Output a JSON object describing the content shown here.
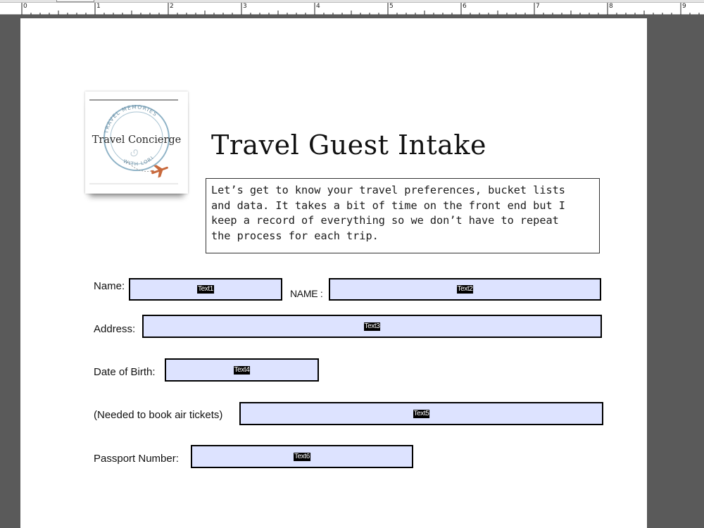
{
  "ruler": {
    "numbers": [
      "0",
      "1",
      "2",
      "3",
      "4",
      "5",
      "6",
      "7",
      "8",
      "9"
    ]
  },
  "logo": {
    "arc_top": "TRAVEL MEMORIES",
    "brand": "Travel Concierge",
    "arc_bottom": "WITH LORI",
    "accent": "#c8693c"
  },
  "title": "Travel Guest Intake",
  "intro_lines": [
    "Let’s get to know your travel preferences, bucket lists",
    "and data. It takes a bit of time on the front end but I",
    "keep a record of everything so we don’t have to repeat",
    "the process for each trip."
  ],
  "form": {
    "name_label": "Name:",
    "name_field": "Text1",
    "name2_label": "NAME :",
    "name2_field": "Text2",
    "address_label": "Address:",
    "address_field": "Text3",
    "dob_label": "Date of Birth:",
    "dob_field": "Text4",
    "air_label": "(Needed to book air tickets)",
    "air_field": "Text5",
    "passport_label": "Passport Number:",
    "passport_field": "Text6"
  },
  "colors": {
    "field_fill": "#dde3ff",
    "workspace": "#5a5a5a"
  }
}
